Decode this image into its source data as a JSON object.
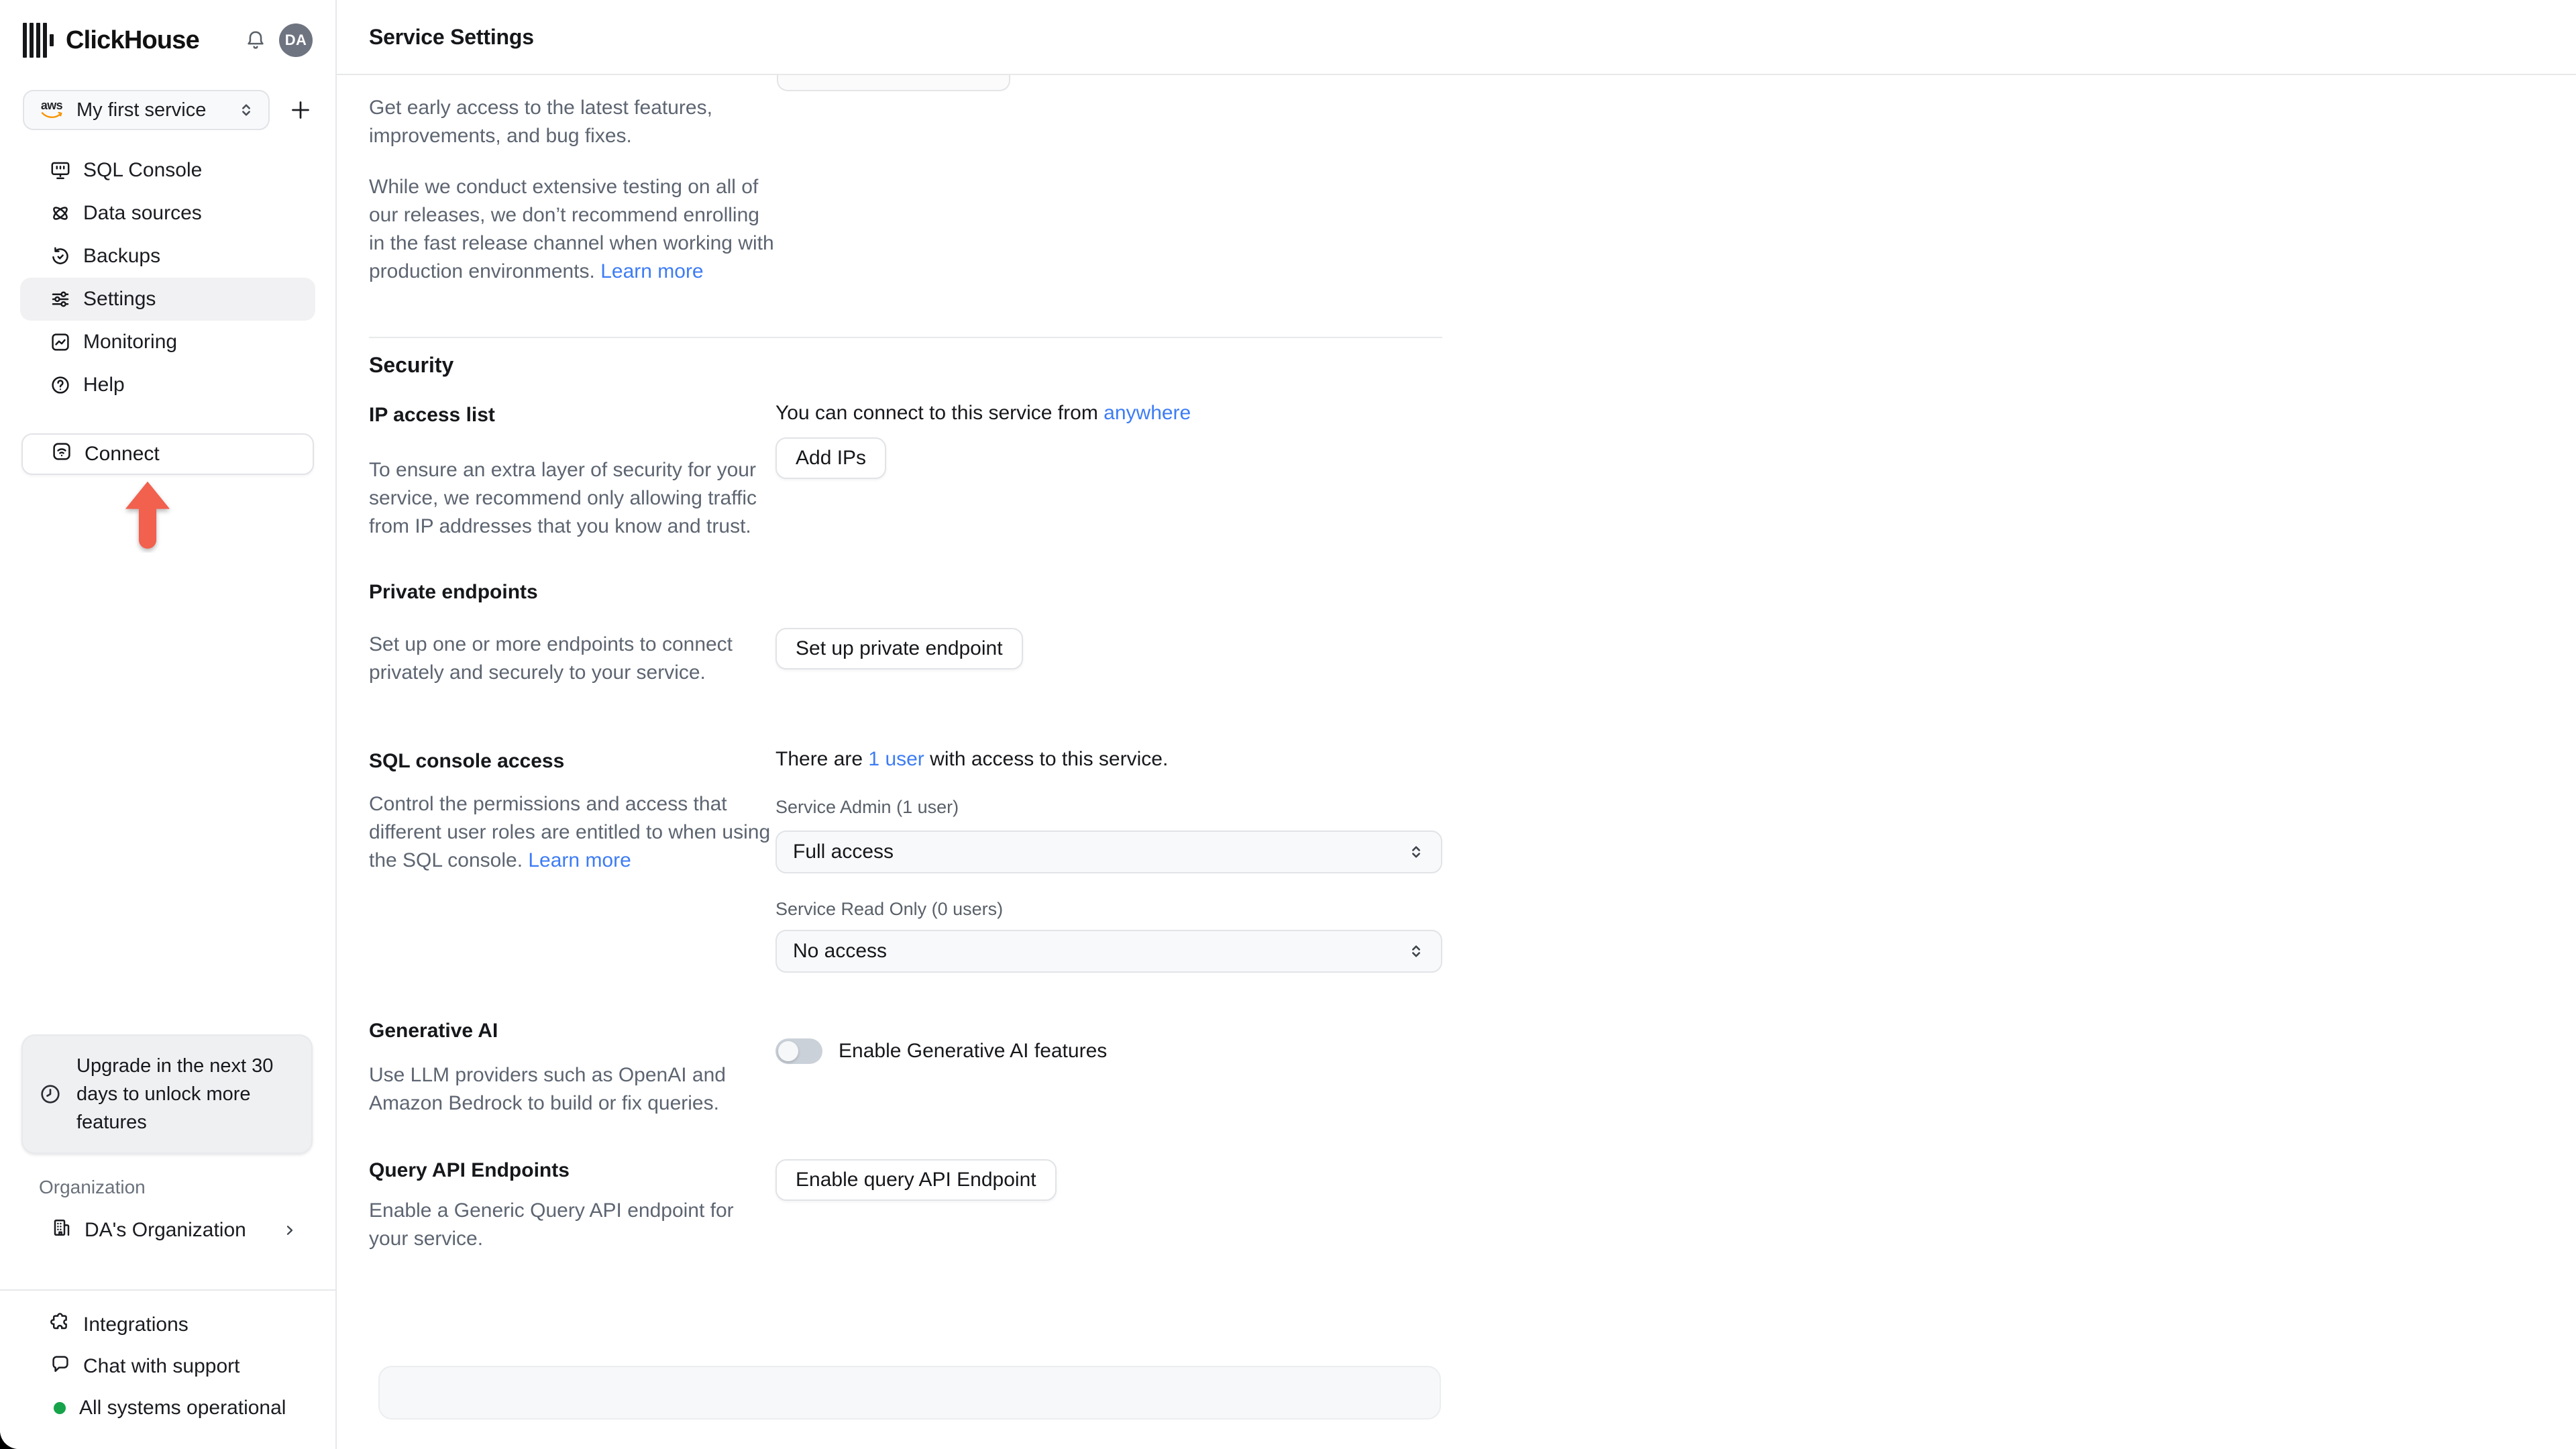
{
  "app": {
    "name": "ClickHouse",
    "page_title": "Service Settings",
    "avatar_initials": "DA"
  },
  "sidebar": {
    "service_selector": {
      "provider": "aws",
      "label": "My first service"
    },
    "nav": [
      {
        "label": "SQL Console"
      },
      {
        "label": "Data sources"
      },
      {
        "label": "Backups"
      },
      {
        "label": "Settings"
      },
      {
        "label": "Monitoring"
      },
      {
        "label": "Help"
      }
    ],
    "connect_label": "Connect",
    "upgrade_notice": "Upgrade in the next 30 days to unlock more features",
    "organization": {
      "section_label": "Organization",
      "name": "DA's Organization"
    },
    "footer": {
      "integrations": "Integrations",
      "chat": "Chat with support",
      "status": "All systems operational"
    }
  },
  "main": {
    "intro_p1": "Get early access to the latest features, improvements, and bug fixes.",
    "intro_p2": "While we conduct extensive testing on all of our releases, we don’t recommend enrolling in the fast release channel when working with production environments.",
    "intro_p2_link": "Learn more",
    "security": {
      "heading": "Security",
      "ip_access": {
        "label": "IP access list",
        "right_prefix": "You can connect to this service from",
        "right_link": "anywhere",
        "button": "Add IPs",
        "description": "To ensure an extra layer of security for your service, we recommend only allowing traffic from IP addresses that you know and trust."
      },
      "private_endpoints": {
        "label": "Private endpoints",
        "description": "Set up one or more endpoints to connect privately and securely to your service.",
        "button": "Set up private endpoint"
      },
      "sql_console_access": {
        "label": "SQL console access",
        "right_prefix": "There are",
        "right_link": "1 user",
        "right_suffix": "with access to this service.",
        "description": "Control the permissions and access that different user roles are entitled to when using the SQL console.",
        "description_link": "Learn more",
        "admin_label": "Service Admin (1 user)",
        "admin_value": "Full access",
        "readonly_label": "Service Read Only (0 users)",
        "readonly_value": "No access"
      },
      "generative_ai": {
        "label": "Generative AI",
        "toggle_label": "Enable Generative AI features",
        "toggle_state": "off",
        "description": "Use LLM providers such as OpenAI and Amazon Bedrock to build or fix queries."
      },
      "query_api": {
        "label": "Query API Endpoints",
        "button": "Enable query API Endpoint",
        "description": "Enable a Generic Query API endpoint for your service."
      }
    }
  },
  "colors": {
    "accent_blue": "#3d7cf5",
    "arrow_red": "#f2604e",
    "status_green": "#16a34a",
    "avatar_gray": "#6e7480"
  }
}
